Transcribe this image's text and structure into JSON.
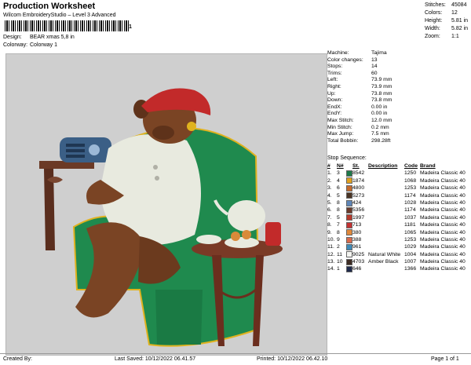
{
  "header": {
    "title": "Production Worksheet",
    "software": "Wilcom EmbroideryStudio – Level 3 Advanced",
    "barcode_number": "1",
    "design_label": "Design:",
    "design_value": "BEAR xmas 5,8 in",
    "colorway_label": "Colorway:",
    "colorway_value": "Colorway 1"
  },
  "stats": [
    {
      "k": "Stitches:",
      "v": "45084"
    },
    {
      "k": "Colors:",
      "v": "12"
    },
    {
      "k": "Height:",
      "v": "5.81 in"
    },
    {
      "k": "Width:",
      "v": "5.82 in"
    },
    {
      "k": "Zoom:",
      "v": "1:1"
    }
  ],
  "params": [
    {
      "k": "Machine:",
      "v": "Tajima"
    },
    {
      "k": "Color changes:",
      "v": "13"
    },
    {
      "k": "Stops:",
      "v": "14"
    },
    {
      "k": "Trims:",
      "v": "60"
    },
    {
      "k": "Left:",
      "v": "73.9 mm"
    },
    {
      "k": "Right:",
      "v": "73.9 mm"
    },
    {
      "k": "Up:",
      "v": "73.8 mm"
    },
    {
      "k": "Down:",
      "v": "73.8 mm"
    },
    {
      "k": "EndX:",
      "v": "0.00 in"
    },
    {
      "k": "EndY:",
      "v": "0.00 in"
    },
    {
      "k": "Max Stitch:",
      "v": "12.0 mm"
    },
    {
      "k": "Min Stitch:",
      "v": "0.2 mm"
    },
    {
      "k": "Max Jump:",
      "v": "7.5 mm"
    },
    {
      "k": "Total Bobbin:",
      "v": "298.28ft"
    }
  ],
  "stop_sequence_label": "Stop Sequence:",
  "columns": [
    "#",
    "N#",
    "St.",
    "Description",
    "Code",
    "Brand"
  ],
  "rows": [
    {
      "num": "1.",
      "n": "3",
      "color": "#1d7a4a",
      "st": "8542",
      "desc": "",
      "code": "1250",
      "brand": "Madeira Classic 40"
    },
    {
      "num": "2.",
      "n": "4",
      "color": "#e0a01e",
      "st": "1874",
      "desc": "",
      "code": "1068",
      "brand": "Madeira Classic 40"
    },
    {
      "num": "3.",
      "n": "6",
      "color": "#c46a2c",
      "st": "4800",
      "desc": "",
      "code": "1253",
      "brand": "Madeira Classic 40"
    },
    {
      "num": "4.",
      "n": "5",
      "color": "#4a3424",
      "st": "5273",
      "desc": "",
      "code": "1174",
      "brand": "Madeira Classic 40"
    },
    {
      "num": "5.",
      "n": "8",
      "color": "#5f86b8",
      "st": "424",
      "desc": "",
      "code": "1028",
      "brand": "Madeira Classic 40"
    },
    {
      "num": "6.",
      "n": "8",
      "color": "#6b3a2a",
      "st": "5356",
      "desc": "",
      "code": "1174",
      "brand": "Madeira Classic 40"
    },
    {
      "num": "7.",
      "n": "5",
      "color": "#b73a2c",
      "st": "1997",
      "desc": "",
      "code": "1037",
      "brand": "Madeira Classic 40"
    },
    {
      "num": "8.",
      "n": "7",
      "color": "#c23232",
      "st": "713",
      "desc": "",
      "code": "1181",
      "brand": "Madeira Classic 40"
    },
    {
      "num": "9.",
      "n": "8",
      "color": "#e0883a",
      "st": "380",
      "desc": "",
      "code": "1065",
      "brand": "Madeira Classic 40"
    },
    {
      "num": "10.",
      "n": "9",
      "color": "#d96a4a",
      "st": "388",
      "desc": "",
      "code": "1253",
      "brand": "Madeira Classic 40"
    },
    {
      "num": "11.",
      "n": "2",
      "color": "#3f8ab8",
      "st": "961",
      "desc": "",
      "code": "1029",
      "brand": "Madeira Classic 40"
    },
    {
      "num": "12.",
      "n": "11",
      "color": "#f4f4f0",
      "st": "9025",
      "desc": "Natural White",
      "code": "1004",
      "brand": "Madeira Classic 40"
    },
    {
      "num": "13.",
      "n": "10",
      "color": "#3d2c24",
      "st": "4703",
      "desc": "Amber Black",
      "code": "1007",
      "brand": "Madeira Classic 40"
    },
    {
      "num": "14.",
      "n": "1",
      "color": "#1f2a4a",
      "st": "646",
      "desc": "",
      "code": "1366",
      "brand": "Madeira Classic 40"
    }
  ],
  "footer": {
    "created_by": "Created By:",
    "last_saved": "Last Saved: 10/12/2022 06.41.57",
    "printed": "Printed: 10/12/2022 06.42.10",
    "page": "Page 1 of 1"
  }
}
